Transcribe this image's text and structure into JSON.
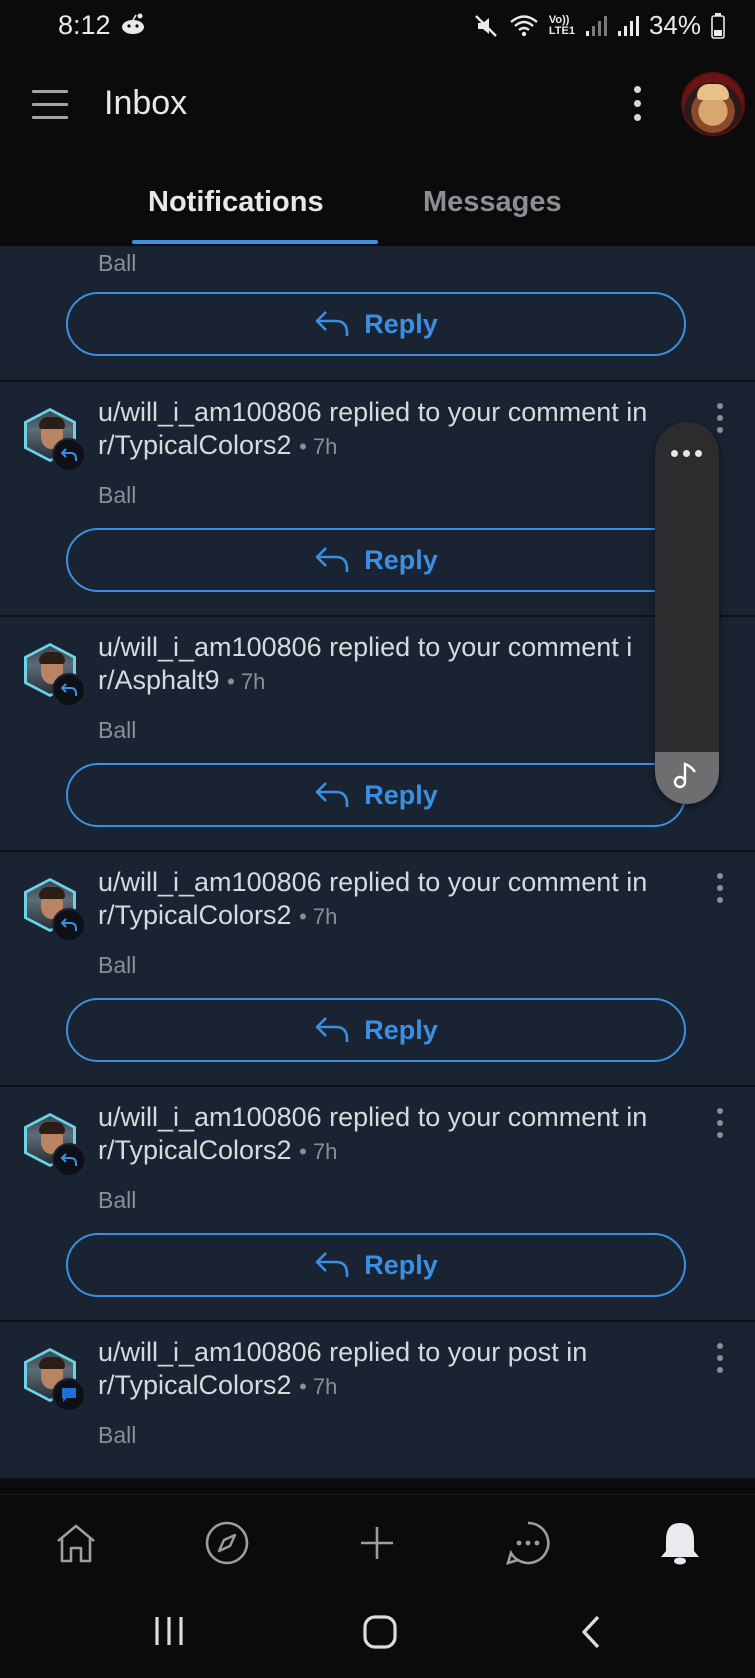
{
  "status_bar": {
    "time": "8:12",
    "battery": "34%",
    "icons": [
      "reddit-icon",
      "mute-icon",
      "wifi-icon",
      "volte-icon",
      "signal-icon",
      "signal-icon",
      "battery-icon"
    ],
    "volte_label": "Vo))",
    "lte_label": "LTE1"
  },
  "header": {
    "title": "Inbox",
    "menu_icon": "hamburger-icon",
    "more_icon": "more-vertical-icon",
    "avatar_icon": "user-avatar"
  },
  "tabs": [
    {
      "label": "Notifications",
      "active": true
    },
    {
      "label": "Messages",
      "active": false
    }
  ],
  "accent_color": "#3b8fe3",
  "card_background": "#1a2331",
  "cards": [
    {
      "partial": true,
      "sub": "Ball",
      "reply_label": "Reply"
    },
    {
      "text": "u/will_i_am100806 replied to your comment in",
      "community": "r/TypicalColors2",
      "time": "• 7h",
      "sub": "Ball",
      "badge": "reply-icon",
      "reply_label": "Reply"
    },
    {
      "text": "u/will_i_am100806 replied to your comment i",
      "community": "r/Asphalt9",
      "time": "• 7h",
      "sub": "Ball",
      "badge": "reply-icon",
      "reply_label": "Reply"
    },
    {
      "text": "u/will_i_am100806 replied to your comment in",
      "community": "r/TypicalColors2",
      "time": "• 7h",
      "sub": "Ball",
      "badge": "reply-icon",
      "reply_label": "Reply"
    },
    {
      "text": "u/will_i_am100806 replied to your comment in",
      "community": "r/TypicalColors2",
      "time": "• 7h",
      "sub": "Ball",
      "badge": "reply-icon",
      "reply_label": "Reply"
    },
    {
      "text": "u/will_i_am100806 replied to your post in",
      "community": "r/TypicalColors2",
      "time": "• 7h",
      "sub": "Ball",
      "badge": "chat-bubble-icon"
    }
  ],
  "floating_panel": {
    "icons": [
      "more-horizontal-icon",
      "music-note-icon"
    ]
  },
  "bottom_nav": [
    {
      "name": "home",
      "icon": "home-icon"
    },
    {
      "name": "explore",
      "icon": "compass-icon"
    },
    {
      "name": "create",
      "icon": "plus-icon"
    },
    {
      "name": "chat",
      "icon": "chat-icon"
    },
    {
      "name": "inbox",
      "icon": "bell-icon",
      "active": true
    }
  ],
  "system_nav": [
    "recents-icon",
    "home-circle-icon",
    "back-icon"
  ]
}
